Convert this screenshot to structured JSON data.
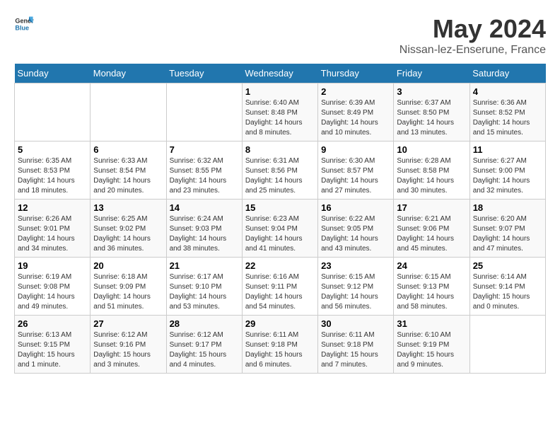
{
  "header": {
    "logo_general": "General",
    "logo_blue": "Blue",
    "title": "May 2024",
    "subtitle": "Nissan-lez-Enserune, France"
  },
  "calendar": {
    "days_of_week": [
      "Sunday",
      "Monday",
      "Tuesday",
      "Wednesday",
      "Thursday",
      "Friday",
      "Saturday"
    ],
    "weeks": [
      {
        "days": [
          {
            "number": "",
            "info": ""
          },
          {
            "number": "",
            "info": ""
          },
          {
            "number": "",
            "info": ""
          },
          {
            "number": "1",
            "info": "Sunrise: 6:40 AM\nSunset: 8:48 PM\nDaylight: 14 hours\nand 8 minutes."
          },
          {
            "number": "2",
            "info": "Sunrise: 6:39 AM\nSunset: 8:49 PM\nDaylight: 14 hours\nand 10 minutes."
          },
          {
            "number": "3",
            "info": "Sunrise: 6:37 AM\nSunset: 8:50 PM\nDaylight: 14 hours\nand 13 minutes."
          },
          {
            "number": "4",
            "info": "Sunrise: 6:36 AM\nSunset: 8:52 PM\nDaylight: 14 hours\nand 15 minutes."
          }
        ]
      },
      {
        "days": [
          {
            "number": "5",
            "info": "Sunrise: 6:35 AM\nSunset: 8:53 PM\nDaylight: 14 hours\nand 18 minutes."
          },
          {
            "number": "6",
            "info": "Sunrise: 6:33 AM\nSunset: 8:54 PM\nDaylight: 14 hours\nand 20 minutes."
          },
          {
            "number": "7",
            "info": "Sunrise: 6:32 AM\nSunset: 8:55 PM\nDaylight: 14 hours\nand 23 minutes."
          },
          {
            "number": "8",
            "info": "Sunrise: 6:31 AM\nSunset: 8:56 PM\nDaylight: 14 hours\nand 25 minutes."
          },
          {
            "number": "9",
            "info": "Sunrise: 6:30 AM\nSunset: 8:57 PM\nDaylight: 14 hours\nand 27 minutes."
          },
          {
            "number": "10",
            "info": "Sunrise: 6:28 AM\nSunset: 8:58 PM\nDaylight: 14 hours\nand 30 minutes."
          },
          {
            "number": "11",
            "info": "Sunrise: 6:27 AM\nSunset: 9:00 PM\nDaylight: 14 hours\nand 32 minutes."
          }
        ]
      },
      {
        "days": [
          {
            "number": "12",
            "info": "Sunrise: 6:26 AM\nSunset: 9:01 PM\nDaylight: 14 hours\nand 34 minutes."
          },
          {
            "number": "13",
            "info": "Sunrise: 6:25 AM\nSunset: 9:02 PM\nDaylight: 14 hours\nand 36 minutes."
          },
          {
            "number": "14",
            "info": "Sunrise: 6:24 AM\nSunset: 9:03 PM\nDaylight: 14 hours\nand 38 minutes."
          },
          {
            "number": "15",
            "info": "Sunrise: 6:23 AM\nSunset: 9:04 PM\nDaylight: 14 hours\nand 41 minutes."
          },
          {
            "number": "16",
            "info": "Sunrise: 6:22 AM\nSunset: 9:05 PM\nDaylight: 14 hours\nand 43 minutes."
          },
          {
            "number": "17",
            "info": "Sunrise: 6:21 AM\nSunset: 9:06 PM\nDaylight: 14 hours\nand 45 minutes."
          },
          {
            "number": "18",
            "info": "Sunrise: 6:20 AM\nSunset: 9:07 PM\nDaylight: 14 hours\nand 47 minutes."
          }
        ]
      },
      {
        "days": [
          {
            "number": "19",
            "info": "Sunrise: 6:19 AM\nSunset: 9:08 PM\nDaylight: 14 hours\nand 49 minutes."
          },
          {
            "number": "20",
            "info": "Sunrise: 6:18 AM\nSunset: 9:09 PM\nDaylight: 14 hours\nand 51 minutes."
          },
          {
            "number": "21",
            "info": "Sunrise: 6:17 AM\nSunset: 9:10 PM\nDaylight: 14 hours\nand 53 minutes."
          },
          {
            "number": "22",
            "info": "Sunrise: 6:16 AM\nSunset: 9:11 PM\nDaylight: 14 hours\nand 54 minutes."
          },
          {
            "number": "23",
            "info": "Sunrise: 6:15 AM\nSunset: 9:12 PM\nDaylight: 14 hours\nand 56 minutes."
          },
          {
            "number": "24",
            "info": "Sunrise: 6:15 AM\nSunset: 9:13 PM\nDaylight: 14 hours\nand 58 minutes."
          },
          {
            "number": "25",
            "info": "Sunrise: 6:14 AM\nSunset: 9:14 PM\nDaylight: 15 hours\nand 0 minutes."
          }
        ]
      },
      {
        "days": [
          {
            "number": "26",
            "info": "Sunrise: 6:13 AM\nSunset: 9:15 PM\nDaylight: 15 hours\nand 1 minute."
          },
          {
            "number": "27",
            "info": "Sunrise: 6:12 AM\nSunset: 9:16 PM\nDaylight: 15 hours\nand 3 minutes."
          },
          {
            "number": "28",
            "info": "Sunrise: 6:12 AM\nSunset: 9:17 PM\nDaylight: 15 hours\nand 4 minutes."
          },
          {
            "number": "29",
            "info": "Sunrise: 6:11 AM\nSunset: 9:18 PM\nDaylight: 15 hours\nand 6 minutes."
          },
          {
            "number": "30",
            "info": "Sunrise: 6:11 AM\nSunset: 9:18 PM\nDaylight: 15 hours\nand 7 minutes."
          },
          {
            "number": "31",
            "info": "Sunrise: 6:10 AM\nSunset: 9:19 PM\nDaylight: 15 hours\nand 9 minutes."
          },
          {
            "number": "",
            "info": ""
          }
        ]
      }
    ]
  }
}
